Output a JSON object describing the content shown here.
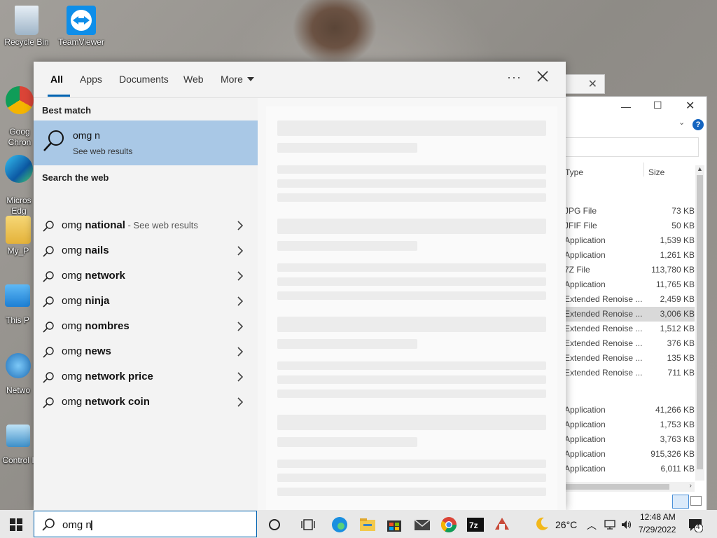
{
  "desktop": {
    "icons": [
      {
        "label": "Recycle Bin"
      },
      {
        "label": "TeamViewer"
      },
      {
        "label": "Goog\nChron"
      },
      {
        "label": "Micros\nEdg"
      },
      {
        "label": "My_P"
      },
      {
        "label": "This P"
      },
      {
        "label": "Netwo"
      },
      {
        "label": "Control I"
      }
    ]
  },
  "search": {
    "tabs": [
      {
        "label": "All"
      },
      {
        "label": "Apps"
      },
      {
        "label": "Documents"
      },
      {
        "label": "Web"
      },
      {
        "label": "More"
      }
    ],
    "more_icon": "ellipsis-icon",
    "close_icon": "close-icon",
    "best_match_title": "Best match",
    "best_match": {
      "title": "omg n",
      "subtitle": "See web results"
    },
    "search_web_title": "Search the web",
    "suggestions": [
      {
        "prefix": "omg ",
        "bold": "national",
        "hint": " - See web results"
      },
      {
        "prefix": "omg ",
        "bold": "nails",
        "hint": ""
      },
      {
        "prefix": "omg ",
        "bold": "network",
        "hint": ""
      },
      {
        "prefix": "omg ",
        "bold": "ninja",
        "hint": ""
      },
      {
        "prefix": "omg ",
        "bold": "nombres",
        "hint": ""
      },
      {
        "prefix": "omg ",
        "bold": "news",
        "hint": ""
      },
      {
        "prefix": "omg ",
        "bold": "network price",
        "hint": ""
      },
      {
        "prefix": "omg ",
        "bold": "network coin",
        "hint": ""
      }
    ],
    "query": "omg n"
  },
  "explorer": {
    "col_type": "Type",
    "col_size": "Size",
    "rows": [
      {
        "type": "JPG File",
        "size": "73 KB"
      },
      {
        "type": "JFIF File",
        "size": "50 KB"
      },
      {
        "type": "Application",
        "size": "1,539 KB"
      },
      {
        "type": "Application",
        "size": "1,261 KB"
      },
      {
        "type": "7Z File",
        "size": "113,780 KB"
      },
      {
        "type": "Application",
        "size": "11,765 KB"
      },
      {
        "type": "Extended Renoise ...",
        "size": "2,459 KB"
      },
      {
        "type": "Extended Renoise ...",
        "size": "3,006 KB"
      },
      {
        "type": "Extended Renoise ...",
        "size": "1,512 KB"
      },
      {
        "type": "Extended Renoise ...",
        "size": "376 KB"
      },
      {
        "type": "Extended Renoise ...",
        "size": "135 KB"
      },
      {
        "type": "Extended Renoise ...",
        "size": "711 KB"
      },
      {
        "type": "Application",
        "size": "41,266 KB"
      },
      {
        "type": "Application",
        "size": "1,753 KB"
      },
      {
        "type": "Application",
        "size": "3,763 KB"
      },
      {
        "type": "Application",
        "size": "915,326 KB"
      },
      {
        "type": "Application",
        "size": "6,011 KB"
      }
    ]
  },
  "taskbar": {
    "weather": "26°C",
    "time": "12:48 AM",
    "date": "7/29/2022",
    "notifications": "4"
  },
  "colors": {
    "accent": "#0063b1",
    "selection": "#a9c8e6"
  }
}
